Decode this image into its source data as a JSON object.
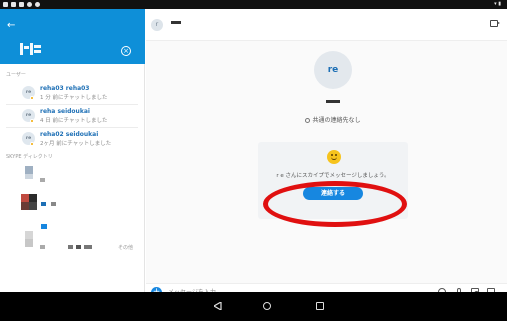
{
  "sidebar": {
    "section_users": "ユーザー",
    "users": [
      {
        "avatar": "re",
        "name": "reha03 reha03",
        "sub": "1 分 前にチャットしました"
      },
      {
        "avatar": "re",
        "name": "reha seidoukai",
        "sub": "4 日 前にチャットしました"
      },
      {
        "avatar": "re",
        "name": "reha02 seidoukai",
        "sub": "2ヶ月 前にチャットしました"
      }
    ],
    "section_directory": "SKYPE ディレクトリ",
    "other_link": "その他"
  },
  "main": {
    "top_avatar": "r",
    "profile_avatar": "re",
    "contacts_text": "共通の連絡先なし",
    "invite_text": "r e さんにスカイプでメッセージしましょう。",
    "connect_button": "連絡する"
  },
  "compose": {
    "placeholder": "メッセージを入力"
  },
  "colors": {
    "accent": "#1787e0",
    "header": "#0e8fd8",
    "annotation": "#e01010"
  }
}
